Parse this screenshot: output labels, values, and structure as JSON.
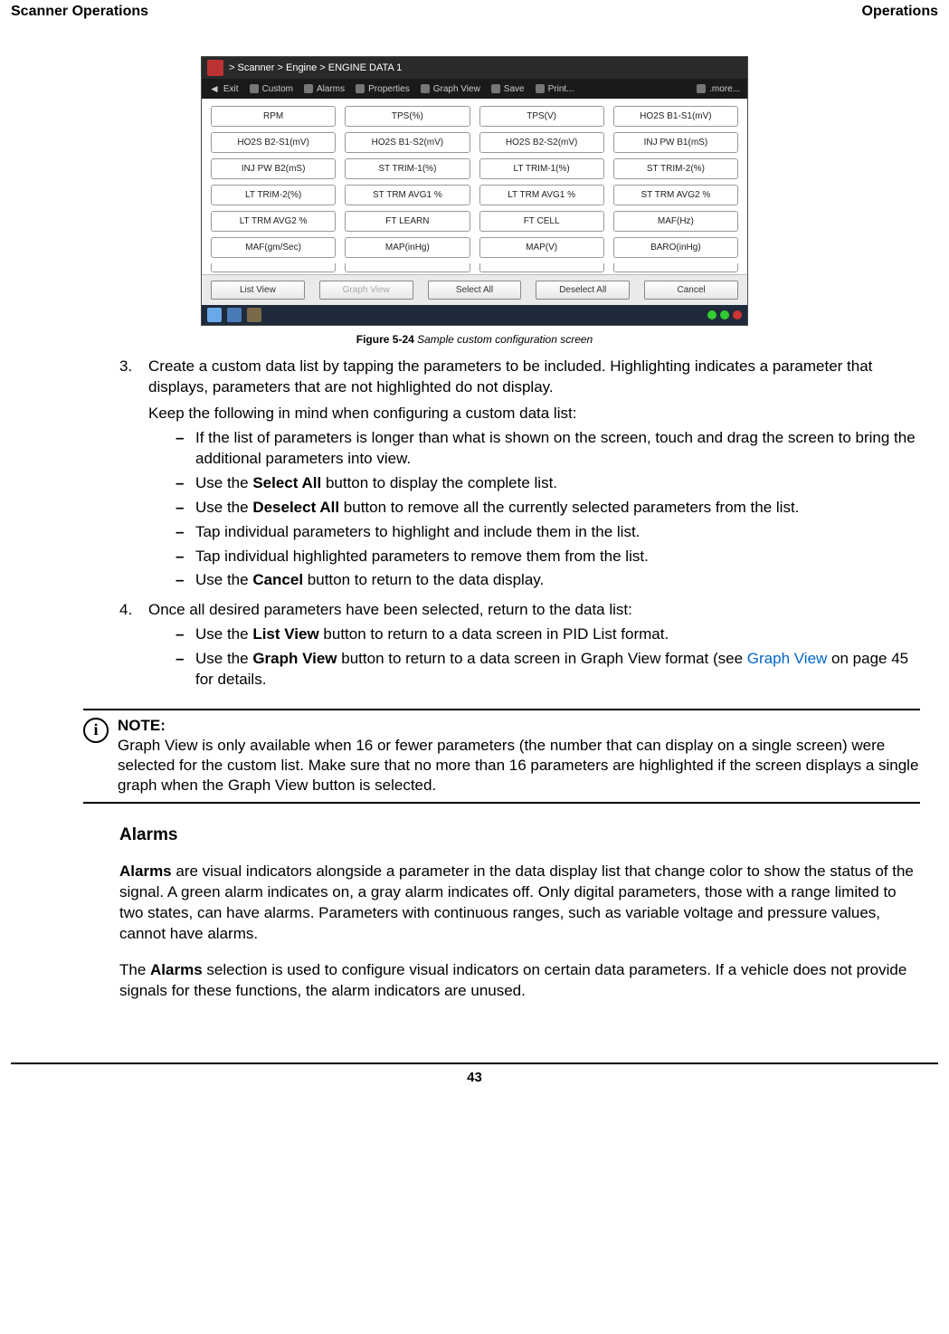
{
  "header": {
    "left": "Scanner Operations",
    "right": "Operations"
  },
  "screenshot": {
    "breadcrumb": "> Scanner  > Engine  > ENGINE DATA 1",
    "toolbar": {
      "exit": "Exit",
      "custom": "Custom",
      "alarms": "Alarms",
      "properties": "Properties",
      "graphview": "Graph View",
      "save": "Save",
      "print": "Print...",
      "more": ".more..."
    },
    "params": [
      "RPM",
      "TPS(%)",
      "TPS(V)",
      "HO2S B1-S1(mV)",
      "HO2S B2-S1(mV)",
      "HO2S B1-S2(mV)",
      "HO2S B2-S2(mV)",
      "INJ PW B1(mS)",
      "INJ PW B2(mS)",
      "ST TRIM-1(%)",
      "LT TRIM-1(%)",
      "ST TRIM-2(%)",
      "LT TRIM-2(%)",
      "ST TRM AVG1 %",
      "LT TRM AVG1 %",
      "ST TRM AVG2 %",
      "LT TRM AVG2 %",
      "FT LEARN",
      "FT CELL",
      "MAF(Hz)",
      "MAF(gm/Sec)",
      "MAP(inHg)",
      "MAP(V)",
      "BARO(inHg)"
    ],
    "bottom": {
      "listview": "List View",
      "graphview": "Graph View",
      "selectall": "Select All",
      "deselectall": "Deselect All",
      "cancel": "Cancel"
    }
  },
  "caption": {
    "num": "Figure 5-24",
    "title": " Sample custom configuration screen"
  },
  "step3": {
    "num": "3.",
    "p1": "Create a custom data list by tapping the parameters to be included. Highlighting indicates a parameter that displays, parameters that are not highlighted do not display.",
    "p2": "Keep the following in mind when configuring a custom data list:",
    "b1": "If the list of parameters is longer than what is shown on the screen, touch and drag the screen to bring the additional parameters into view.",
    "b2a": "Use the ",
    "b2b": "Select All",
    "b2c": " button to display the complete list.",
    "b3a": "Use the ",
    "b3b": "Deselect All",
    "b3c": " button to remove all the currently selected parameters from the list.",
    "b4": "Tap individual parameters to highlight and include them in the list.",
    "b5": "Tap individual highlighted parameters to remove them from the list.",
    "b6a": "Use the ",
    "b6b": "Cancel",
    "b6c": " button to return to the data display."
  },
  "step4": {
    "num": "4.",
    "p1": "Once all desired parameters have been selected, return to the data list:",
    "b1a": "Use the ",
    "b1b": "List View",
    "b1c": " button to return to a data screen in PID List format.",
    "b2a": "Use the ",
    "b2b": "Graph View",
    "b2c": " button to return to a data screen in Graph View format (see ",
    "b2link1": "Graph View",
    "b2d": " on page 45 for details."
  },
  "note": {
    "title": "NOTE:",
    "body": "Graph View is only available when 16 or fewer parameters (the number that can display on a single screen) were selected for the custom list. Make sure that no more than 16 parameters are highlighted if the screen displays a single graph when the Graph View button is selected."
  },
  "alarms": {
    "heading": "Alarms",
    "p1a": "Alarms",
    "p1b": " are visual indicators alongside a parameter in the data display list that change color to show the status of the signal. A green alarm indicates on, a gray alarm indicates off. Only digital parameters, those with a range limited to two states, can have alarms. Parameters with continuous ranges, such as variable voltage and pressure values, cannot have alarms.",
    "p2a": "The ",
    "p2b": "Alarms",
    "p2c": " selection is used to configure visual indicators on certain data parameters. If a vehicle does not provide signals for these functions, the alarm indicators are unused."
  },
  "footer": {
    "page": "43"
  }
}
